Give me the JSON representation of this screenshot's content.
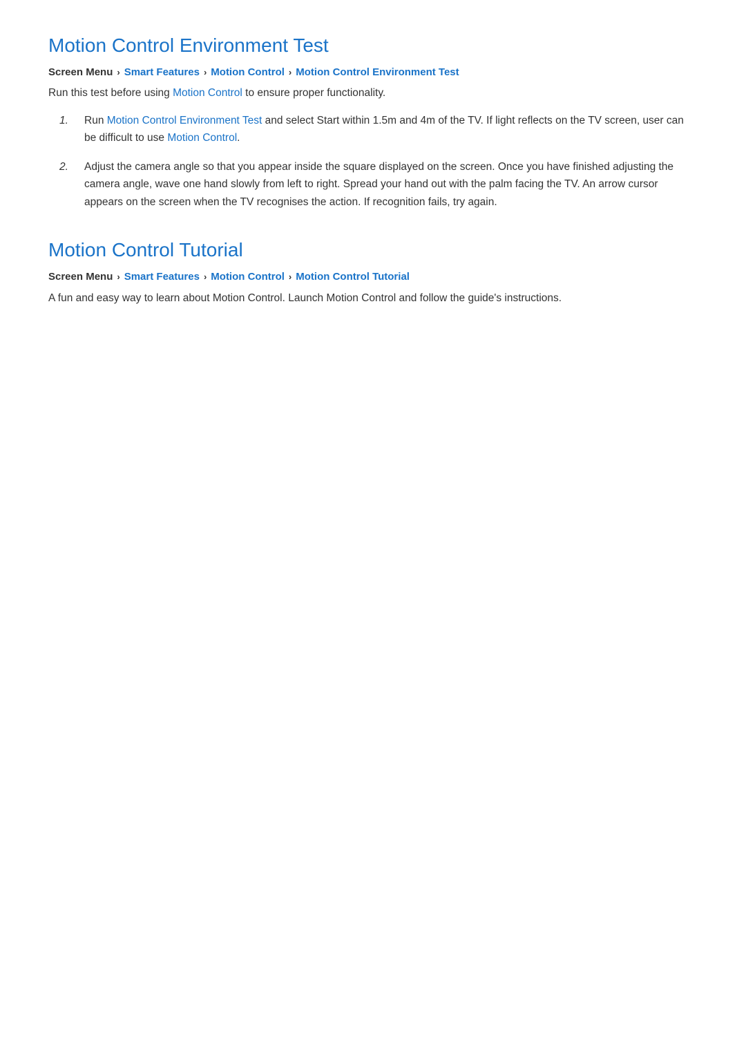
{
  "section1": {
    "title": "Motion Control Environment Test",
    "breadcrumb": {
      "screen_menu": "Screen Menu",
      "smart_features": "Smart Features",
      "motion_control": "Motion Control",
      "current": "Motion Control Environment Test"
    },
    "intro": {
      "before": "Run this test before using ",
      "link_text": "Motion Control",
      "after": " to ensure proper functionality."
    },
    "items": [
      {
        "number": "1.",
        "before": "Run ",
        "link_text": "Motion Control Environment Test",
        "after": " and select Start within 1.5m and 4m of the TV. If light reflects on the TV screen, user can be difficult to use ",
        "link2_text": "Motion Control",
        "end": "."
      },
      {
        "number": "2.",
        "text": "Adjust the camera angle so that you appear inside the square displayed on the screen. Once you have finished adjusting the camera angle, wave one hand slowly from left to right. Spread your hand out with the palm facing the TV. An arrow cursor appears on the screen when the TV recognises the action. If recognition fails, try again."
      }
    ]
  },
  "section2": {
    "title": "Motion Control Tutorial",
    "breadcrumb": {
      "screen_menu": "Screen Menu",
      "smart_features": "Smart Features",
      "motion_control": "Motion Control",
      "current": "Motion Control Tutorial"
    },
    "intro": "A fun and easy way to learn about Motion Control. Launch Motion Control and follow the guide's instructions."
  },
  "colors": {
    "link": "#1a73c8",
    "text": "#333333",
    "title": "#1a73c8"
  }
}
